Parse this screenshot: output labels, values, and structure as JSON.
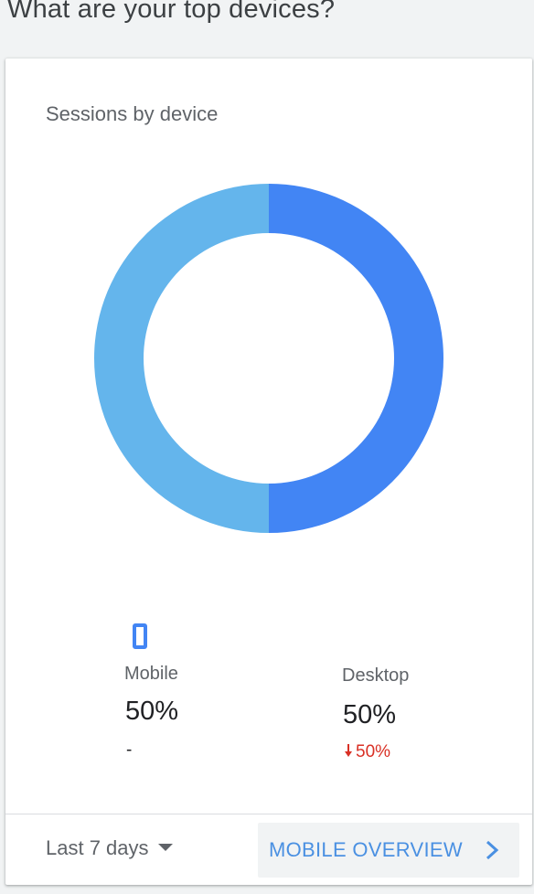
{
  "page": {
    "title": "What are your top devices?"
  },
  "card": {
    "title": "Sessions by device",
    "date_range": "Last 7 days",
    "overview_button": "MOBILE OVERVIEW"
  },
  "devices": [
    {
      "label": "Mobile",
      "value": "50%",
      "change": "-",
      "icon": "phone-icon"
    },
    {
      "label": "Desktop",
      "value": "50%",
      "change": "50%",
      "change_direction": "down",
      "icon": "down-arrow-icon"
    }
  ],
  "colors": {
    "mobile": "#64b5ec",
    "desktop": "#4285f4",
    "negative": "#d93025",
    "link": "#4a90e2"
  },
  "chart_data": {
    "type": "pie",
    "title": "Sessions by device",
    "categories": [
      "Desktop",
      "Mobile"
    ],
    "values": [
      50,
      50
    ],
    "colors": [
      "#4285f4",
      "#64b5ec"
    ]
  }
}
